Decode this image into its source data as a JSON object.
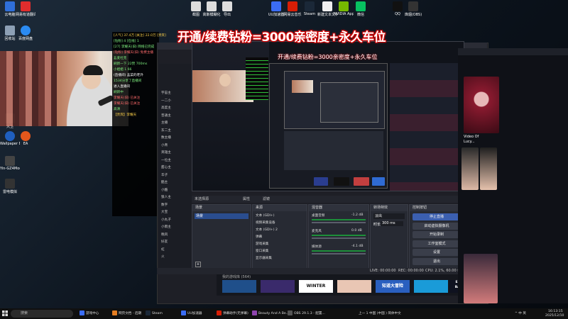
{
  "desktop_icons": [
    {
      "label": "云电脑",
      "color": "#2f6fd9"
    },
    {
      "label": "网易有道翻译",
      "color": "#e12d2d"
    },
    {
      "label": "回收站",
      "color": "#8da0b5"
    },
    {
      "label": "百度网盘",
      "color": "#2b8bf2"
    },
    {
      "label": "Wallpaper Engine",
      "color": "#1f5fbf"
    },
    {
      "label": "EA",
      "color": "#e2571c"
    },
    {
      "label": "Yin-GZ4Mod...",
      "color": "#444"
    },
    {
      "label": "雷电模拟",
      "color": "#333"
    },
    {
      "label": "大卫",
      "color": "#555"
    }
  ],
  "top_icons": [
    {
      "label": "截图",
      "color": "#ddd"
    },
    {
      "label": "高斯模糊化",
      "color": "#ddd"
    },
    {
      "label": "导出",
      "color": "#ddd"
    },
    {
      "label": "UU加速器",
      "color": "#3b6df5"
    },
    {
      "label": "网易云音乐",
      "color": "#d81e06"
    },
    {
      "label": "Steam",
      "color": "#1b2838"
    },
    {
      "label": "新建文本文档",
      "color": "#eee"
    },
    {
      "label": "NVIDIA App",
      "color": "#76b900"
    },
    {
      "label": "微信",
      "color": "#07c160"
    },
    {
      "label": "QQ",
      "color": "#111"
    },
    {
      "label": "烽烟(OBS)",
      "color": "#333"
    }
  ],
  "banner": "开通/续费钻粉=3000亲密度+永久车位",
  "banner_small": "开通/续费钻粉=3000亲密度+永久车位",
  "chat": [
    "[人气] 37.4万 [关注] 22.0万 [贵宾]",
    "[钻粉] 4 [在线] 1",
    "[27] 李耀天(旧) 网络已完成",
    "[钻粉] 李耀天(旧) 免费主播",
    "韭麦杜克",
    "刷新一下 22赞 700ms",
    "小姐姐 1 66",
    "(直播间) 韭菜的老外",
    "1534分享了直播间",
    "进入直播间",
    "刷新中",
    "李耀天(旧) 已关注",
    "李耀天(旧) 已关注",
    "高清",
    "【贵宾】李耀天"
  ],
  "chat_users": [
    "宇宙主",
    "一二小",
    "高度主",
    "普通主",
    "主播",
    "东二主",
    "数主播",
    "小青",
    "英雄主",
    "一位主",
    "甜心主",
    "华子",
    "酷主",
    "小酷",
    "狼人主",
    "数字",
    "大宝",
    "小丸子",
    "小雨主",
    "晚风",
    "好友",
    "虹",
    "火"
  ],
  "scenes_panel": {
    "title": "场景",
    "item": "场景"
  },
  "sources_panel": {
    "title": "来源",
    "items": [
      "文本 (GDI+)",
      "视频采集设备",
      "文本 (GDI+) 2",
      "弹幕",
      "游戏采集",
      "窗口采集",
      "显示器采集"
    ]
  },
  "mixer_panel": {
    "title": "混音器",
    "tracks": [
      {
        "name": "桌面音频",
        "db": "-1.2 dB"
      },
      {
        "name": "麦克风",
        "db": "0.0 dB"
      },
      {
        "name": "媒体源",
        "db": "-4.1 dB"
      }
    ]
  },
  "transition_panel": {
    "title": "转场特效",
    "type": "淡出",
    "duration_label": "时长",
    "duration": "300 ms"
  },
  "controls_panel": {
    "title": "控制按钮",
    "buttons": [
      "停止直播",
      "启动虚拟摄像机",
      "开始录制",
      "工作室模式",
      "设置",
      "退出"
    ]
  },
  "no_source": "未选择源",
  "properties": "属性",
  "filters": "滤镜",
  "status_bar": {
    "live": "LIVE: 00:00:00",
    "rec": "REC: 00:00:00",
    "cpu": "CPU: 2.1%, 60.00 fps"
  },
  "strip": {
    "label": "我的游戏库 (564)",
    "games": [
      "",
      "",
      "WINTER",
      "",
      "知道大冒险",
      "",
      "ESCAPE THE BACKROOMS"
    ]
  },
  "browser_text": [
    "Video Of",
    "Lucy..."
  ],
  "taskbar": {
    "search_placeholder": "搜索",
    "apps": [
      "游戏中心",
      "网页文档 - 后期",
      "Steam",
      "UU加速器",
      "弹幕助手(无弹幕)",
      "Beauty And A Be...",
      "OBS 29.1.3 - 配置..."
    ],
    "status_text": "上一 1 中国 (中国 ) 简体中文",
    "tray": "^  中  英",
    "time": "16:13:15",
    "date": "2025/12/10"
  }
}
